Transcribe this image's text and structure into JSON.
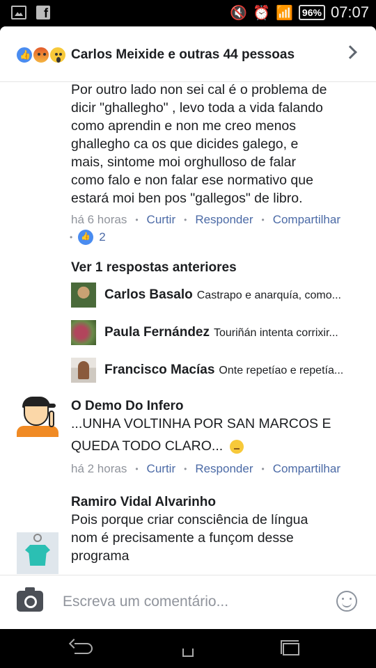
{
  "status_bar": {
    "battery": "96%",
    "time": "07:07"
  },
  "header": {
    "title": "Carlos Meixide e outras 44 pessoas",
    "reaction_icons": [
      "like-icon",
      "angry-icon",
      "wow-icon"
    ]
  },
  "comment_top": {
    "lines": [
      "Por outro lado non sei cal é o problema de",
      "dicir \"ghallegho\" , levo toda a vida falando",
      "como aprendin e non me creo menos",
      "ghallegho ca os que dicides galego, e",
      "mais, sintome moi orghulloso de falar",
      "como falo e non falar ese normativo que",
      "estará moi ben pos \"gallegos\" de libro."
    ],
    "time": "há 6 horas",
    "like_label": "Curtir",
    "reply_label": "Responder",
    "share_label": "Compartilhar",
    "like_count": "2"
  },
  "view_previous": "Ver 1 respostas anteriores",
  "replies": [
    {
      "name": "Carlos Basalo",
      "text": "Castrapo e anarquía, como..."
    },
    {
      "name": "Paula Fernández",
      "text": "Touriñán intenta corrixir..."
    },
    {
      "name": "Francisco Macías",
      "text": "Onte repetíao e repetía..."
    }
  ],
  "comment_demo": {
    "name": "O Demo Do Infero",
    "line1": "...UNHA VOLTINHA POR SAN MARCOS E",
    "line2": "QUEDA TODO CLARO...",
    "time": "há 2 horas",
    "like_label": "Curtir",
    "reply_label": "Responder",
    "share_label": "Compartilhar"
  },
  "comment_ramiro": {
    "name": "Ramiro Vidal Alvarinho",
    "lines": [
      "Pois porque criar consciência de língua",
      "nom é precisamente a funçom desse",
      "programa"
    ]
  },
  "composer": {
    "placeholder": "Escreva um comentário..."
  },
  "colors": {
    "link": "#4b6aa6",
    "meta": "#90949c",
    "like_blue": "#4a8cf0"
  }
}
